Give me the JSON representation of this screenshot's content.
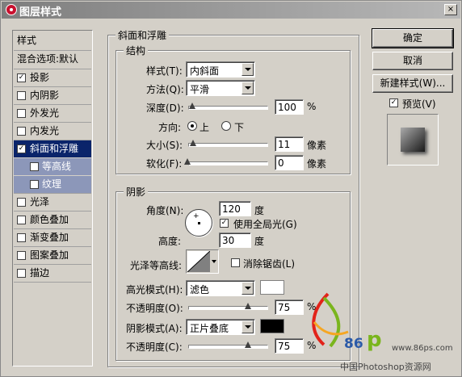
{
  "window": {
    "title": "图层样式",
    "close": "×"
  },
  "sidebar": {
    "items": [
      {
        "label": "样式"
      },
      {
        "label": "混合选项:默认"
      },
      {
        "label": "投影",
        "checked": true
      },
      {
        "label": "内阴影",
        "checked": false
      },
      {
        "label": "外发光",
        "checked": false
      },
      {
        "label": "内发光",
        "checked": false
      },
      {
        "label": "斜面和浮雕",
        "checked": true
      },
      {
        "label": "等高线",
        "checked": false
      },
      {
        "label": "纹理",
        "checked": false
      },
      {
        "label": "光泽",
        "checked": false
      },
      {
        "label": "颜色叠加",
        "checked": false
      },
      {
        "label": "渐变叠加",
        "checked": false
      },
      {
        "label": "图案叠加",
        "checked": false
      },
      {
        "label": "描边",
        "checked": false
      }
    ]
  },
  "bevel": {
    "title": "斜面和浮雕",
    "structure": {
      "title": "结构",
      "style_label": "样式(T):",
      "style_value": "内斜面",
      "technique_label": "方法(Q):",
      "technique_value": "平滑",
      "depth_label": "深度(D):",
      "depth_value": "100",
      "depth_unit": "%",
      "direction_label": "方向:",
      "direction_up": "上",
      "direction_down": "下",
      "size_label": "大小(S):",
      "size_value": "11",
      "size_unit": "像素",
      "soften_label": "软化(F):",
      "soften_value": "0",
      "soften_unit": "像素"
    },
    "shading": {
      "title": "阴影",
      "angle_label": "角度(N):",
      "angle_value": "120",
      "angle_unit": "度",
      "global_light_label": "使用全局光(G)",
      "global_light_checked": true,
      "altitude_label": "高度:",
      "altitude_value": "30",
      "altitude_unit": "度",
      "gloss_label": "光泽等高线:",
      "antialias_label": "消除锯齿(L)",
      "antialias_checked": false,
      "highlight_label": "高光模式(H):",
      "highlight_value": "滤色",
      "highlight_color": "#ffffff",
      "highlight_opacity_label": "不透明度(O):",
      "highlight_opacity_value": "75",
      "highlight_opacity_unit": "%",
      "shadow_label": "阴影模式(A):",
      "shadow_value": "正片叠底",
      "shadow_color": "#000000",
      "shadow_opacity_label": "不透明度(C):",
      "shadow_opacity_value": "75",
      "shadow_opacity_unit": "%"
    }
  },
  "buttons": {
    "ok": "确定",
    "cancel": "取消",
    "new_style": "新建样式(W)...",
    "preview_label": "预览(V)",
    "preview_checked": true
  },
  "watermark": {
    "num": "86",
    "letter": "p",
    "url": "www.86ps.com",
    "caption": "中国Photoshop资源网"
  },
  "colors": {
    "selection": "#0a246a",
    "sub_items": "#8c97b9",
    "title_bar": "#9a9a9a"
  }
}
